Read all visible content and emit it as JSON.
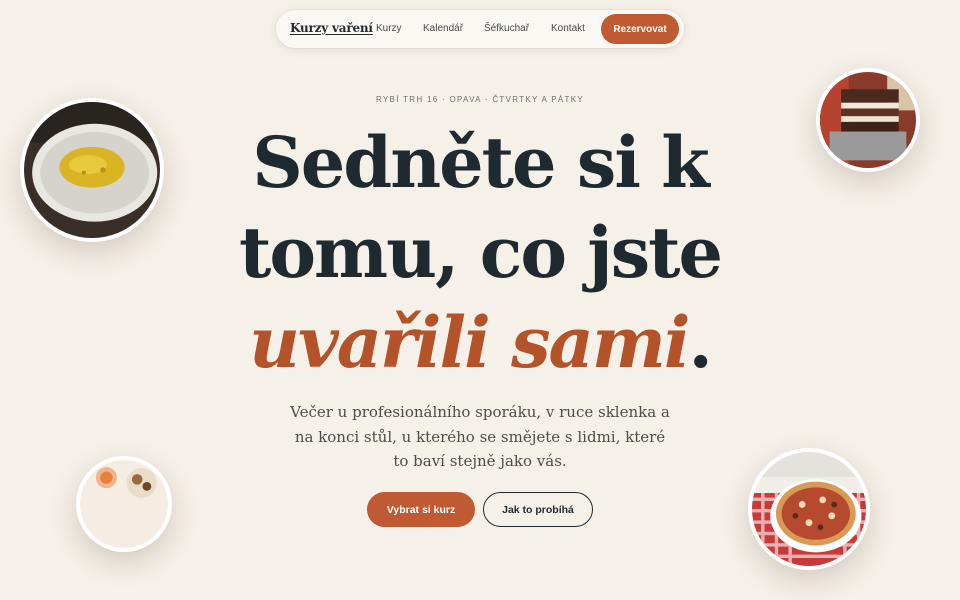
{
  "nav": {
    "brand": "Kurzy vaření",
    "links": [
      "Kurzy",
      "Kalendář",
      "Šéfkuchař",
      "Kontakt"
    ],
    "cta": "Rezervovat"
  },
  "hero": {
    "eyebrow": "RYBÍ TRH 16 · OPAVA · ČTVRTKY A PÁTKY",
    "headline_line1": "Sedněte si k",
    "headline_line2": "tomu, co jste",
    "headline_accent": "uvařili sami",
    "headline_period": ".",
    "lead": "Večer u profesionálního sporáku, v ruce sklenka a na konci stůl, u kterého se smějete s lidmi, které to baví stejně jako vás.",
    "primary_button": "Vybrat si kurz",
    "secondary_button": "Jak to probíhá"
  },
  "photos": {
    "soup": "soup-photo",
    "cake": "cake-photo",
    "drinks": "drinks-photo",
    "pizza": "pizza-photo"
  },
  "colors": {
    "background": "#f5f0e8",
    "accent": "#c05a33",
    "ink": "#1f2a30"
  }
}
